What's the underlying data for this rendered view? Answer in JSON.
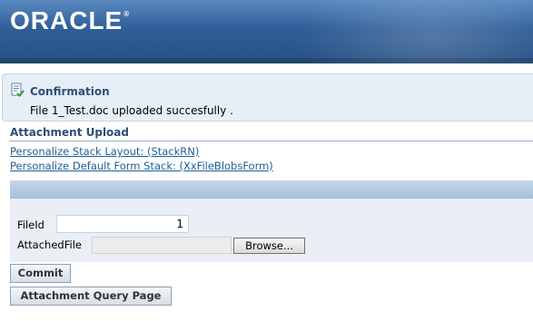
{
  "branding": {
    "logo_text": "ORACLE",
    "logo_mark": "®"
  },
  "confirmation": {
    "icon": "confirmation-document-check-icon",
    "title": "Confirmation",
    "message": "File 1_Test.doc uploaded succesfully ."
  },
  "section": {
    "title": "Attachment Upload",
    "links": [
      "Personalize Stack Layout: (StackRN)",
      "Personalize Default Form Stack: (XxFileBlobsForm)"
    ]
  },
  "form": {
    "fileid_label": "FileId",
    "fileid_value": "1",
    "attached_label": "AttachedFile",
    "browse_label": "Browse..."
  },
  "buttons": {
    "commit": "Commit",
    "query_page": "Attachment Query Page"
  }
}
